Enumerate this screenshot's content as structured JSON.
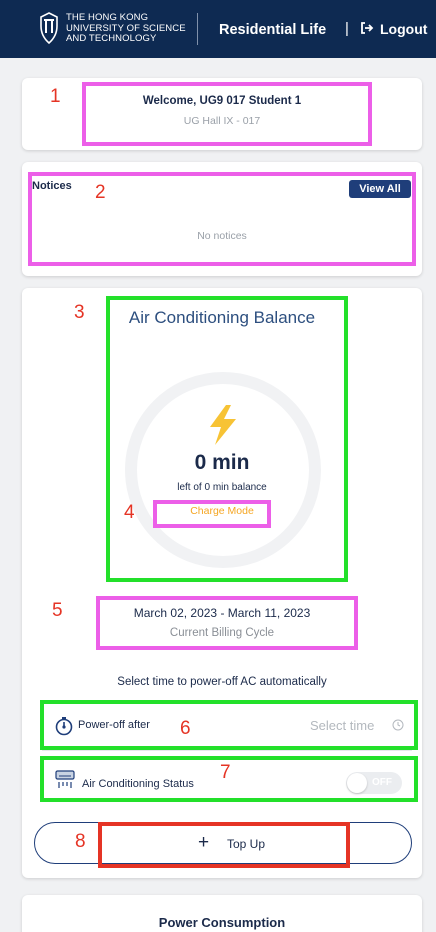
{
  "header": {
    "university_lines": [
      "THE HONG KONG",
      "UNIVERSITY OF SCIENCE",
      "AND TECHNOLOGY"
    ],
    "app_title": "Residential Life",
    "pipe": "|",
    "logout_label": "Logout",
    "background": "#0e2a52"
  },
  "welcome": {
    "greeting": "Welcome, UG9 017 Student 1",
    "hall": "UG Hall IX - 017"
  },
  "notices": {
    "title": "Notices",
    "view_all_label": "View All",
    "empty_text": "No notices"
  },
  "ac_balance": {
    "title": "Air Conditioning Balance",
    "minutes": "0 min",
    "subtitle": "left of 0 min balance",
    "mode": "Charge Mode"
  },
  "billing": {
    "dates": "March 02, 2023 - March 11, 2023",
    "label": "Current Billing Cycle"
  },
  "controls": {
    "instruction": "Select time to power-off AC automatically",
    "power_off_label": "Power-off after",
    "select_time_placeholder": "Select time",
    "ac_status_label": "Air Conditioning Status",
    "toggle_state": "OFF",
    "topup_label": "Top Up",
    "plus_symbol": "+"
  },
  "power_consumption": {
    "title": "Power Consumption"
  },
  "annotations": [
    "1",
    "2",
    "3",
    "4",
    "5",
    "6",
    "7",
    "8"
  ],
  "colors": {
    "brand_navy": "#0e2a52",
    "accent_orange": "#f5a623",
    "annotation_pink": "#ec5fe8",
    "annotation_green": "#23e02a",
    "annotation_red": "#e53425"
  }
}
